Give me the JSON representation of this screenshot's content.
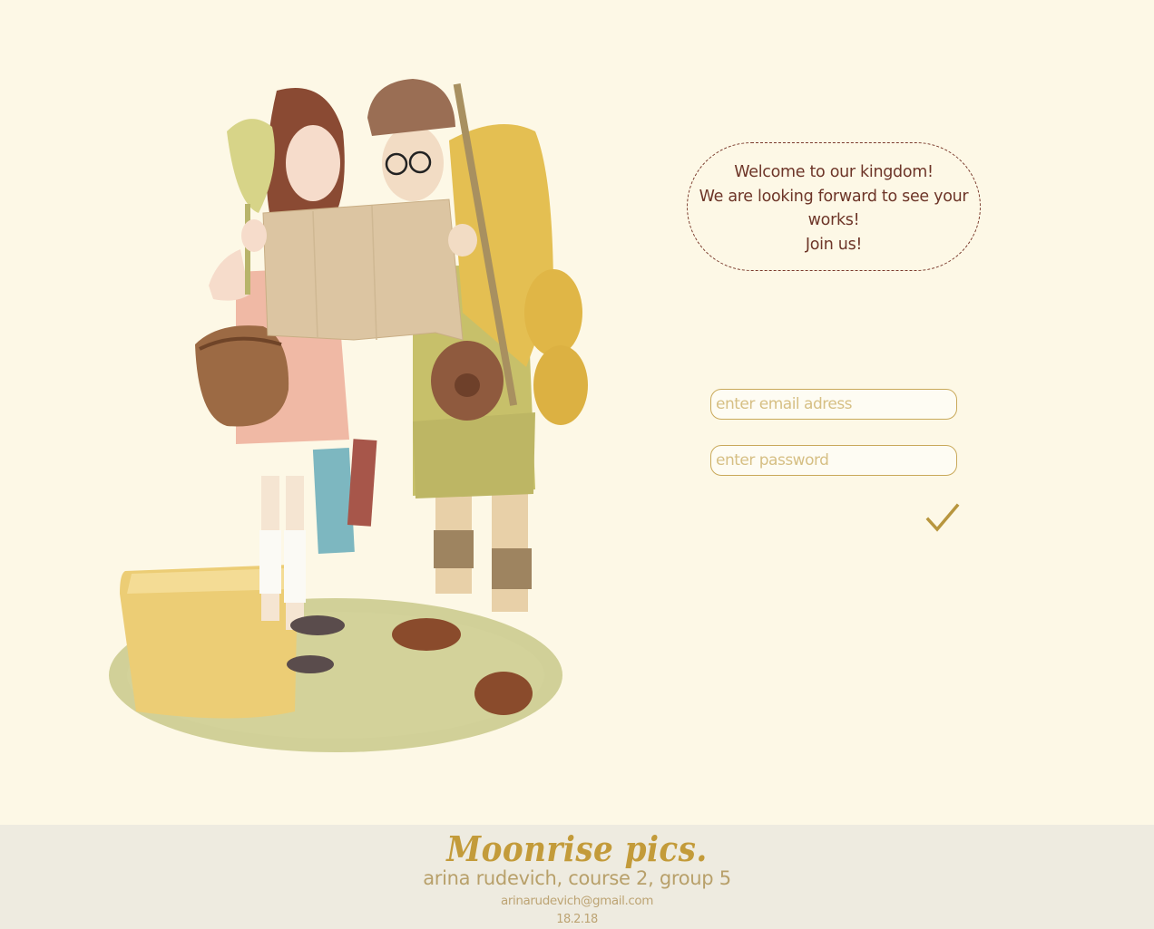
{
  "welcome": {
    "line1": "Welcome to our kingdom!",
    "line2": "We are looking forward to see your works!",
    "line3": "Join us!"
  },
  "form": {
    "email_placeholder": "enter email adress",
    "password_placeholder": "enter password",
    "submit_icon": "checkmark-icon"
  },
  "footer": {
    "brand": "Moonrise pics.",
    "author": "arina rudevich, course 2, group 5",
    "email": "arinarudevich@gmail.com",
    "date": "18.2.18"
  },
  "colors": {
    "background": "#fdf8e6",
    "accent": "#c39b3a",
    "welcome_text": "#6d3528",
    "footer_bg": "#eeebe0"
  }
}
